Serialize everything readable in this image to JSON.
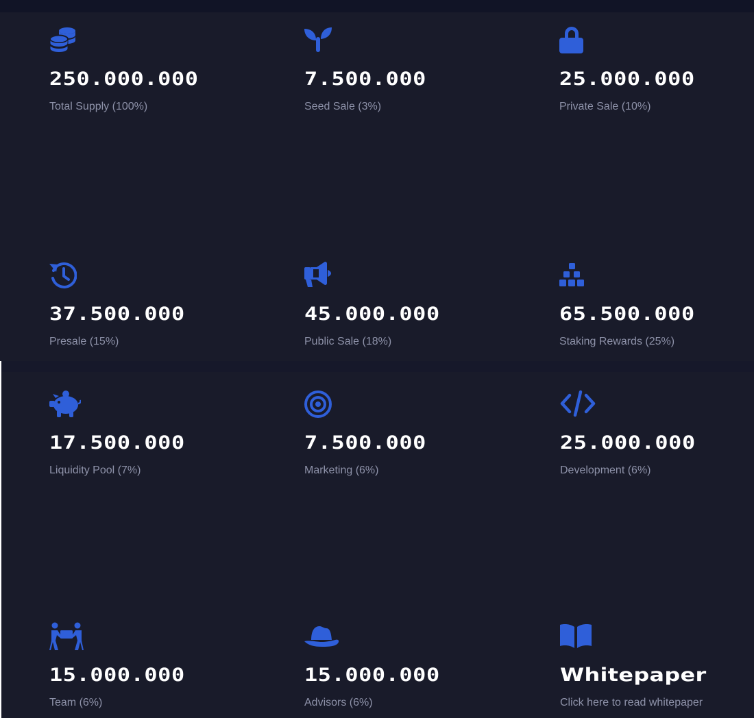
{
  "colors": {
    "accent": "#2f5fd9",
    "panel": "#191b2a",
    "value": "#ffffff",
    "label": "#8e92a9"
  },
  "stats": [
    {
      "icon": "coins-stack-icon",
      "value": "250.000.000",
      "label": "Total Supply (100%)"
    },
    {
      "icon": "seedling-icon",
      "value": "7.500.000",
      "label": "Seed Sale (3%)"
    },
    {
      "icon": "lock-icon",
      "value": "25.000.000",
      "label": "Private Sale (10%)"
    },
    {
      "icon": "history-icon",
      "value": "37.500.000",
      "label": "Presale (15%)"
    },
    {
      "icon": "megaphone-icon",
      "value": "45.000.000",
      "label": "Public Sale (18%)"
    },
    {
      "icon": "cubes-stacked-icon",
      "value": "65.500.000",
      "label": "Staking Rewards (25%)"
    },
    {
      "icon": "piggy-bank-icon",
      "value": "17.500.000",
      "label": "Liquidity Pool (7%)"
    },
    {
      "icon": "bullseye-icon",
      "value": "7.500.000",
      "label": "Marketing (6%)"
    },
    {
      "icon": "code-icon",
      "value": "25.000.000",
      "label": "Development (6%)"
    },
    {
      "icon": "people-carry-icon",
      "value": "15.000.000",
      "label": "Team (6%)"
    },
    {
      "icon": "cowboy-hat-icon",
      "value": "15.000.000",
      "label": "Advisors (6%)"
    }
  ],
  "whitepaper": {
    "icon": "book-open-icon",
    "title": "Whitepaper",
    "link_text": "Click here to read whitepaper"
  }
}
